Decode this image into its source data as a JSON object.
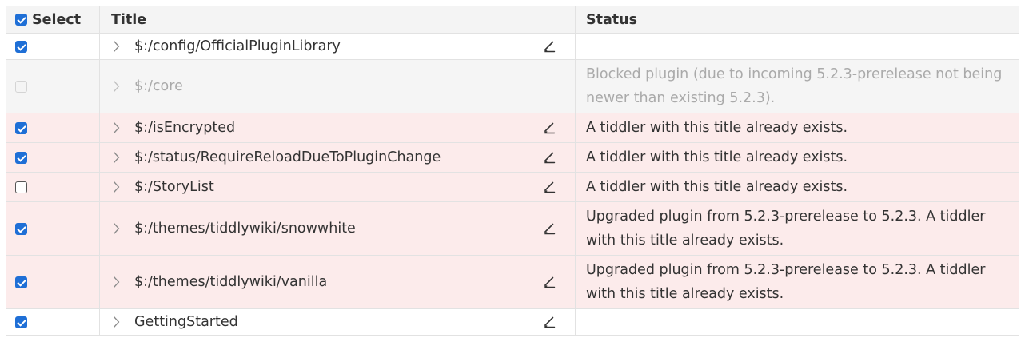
{
  "table": {
    "headers": {
      "select": "Select",
      "title": "Title",
      "status": "Status"
    },
    "select_all_checked": true,
    "rows": [
      {
        "checked": "checked",
        "title": "$:/config/OfficialPluginLibrary",
        "status": "",
        "editable": true,
        "variant": "normal",
        "chevron_icon": "chevron-right-icon",
        "edit_icon": "pencil-icon"
      },
      {
        "checked": "disabled",
        "title": "$:/core",
        "status": "Blocked plugin (due to incoming 5.2.3-prerelease not being newer than existing 5.2.3).",
        "editable": false,
        "variant": "blocked",
        "chevron_icon": "chevron-right-icon"
      },
      {
        "checked": "checked",
        "title": "$:/isEncrypted",
        "status": "A tiddler with this title already exists.",
        "editable": true,
        "variant": "warn",
        "chevron_icon": "chevron-right-icon",
        "edit_icon": "pencil-icon"
      },
      {
        "checked": "checked",
        "title": "$:/status/RequireReloadDueToPluginChange",
        "status": "A tiddler with this title already exists.",
        "editable": true,
        "variant": "warn",
        "chevron_icon": "chevron-right-icon",
        "edit_icon": "pencil-icon"
      },
      {
        "checked": "unchecked",
        "title": "$:/StoryList",
        "status": "A tiddler with this title already exists.",
        "editable": true,
        "variant": "warn",
        "chevron_icon": "chevron-right-icon",
        "edit_icon": "pencil-icon"
      },
      {
        "checked": "checked",
        "title": "$:/themes/tiddlywiki/snowwhite",
        "status": "Upgraded plugin from 5.2.3-prerelease to 5.2.3. A tiddler with this title already exists.",
        "editable": true,
        "variant": "warn",
        "chevron_icon": "chevron-right-icon",
        "edit_icon": "pencil-icon"
      },
      {
        "checked": "checked",
        "title": "$:/themes/tiddlywiki/vanilla",
        "status": "Upgraded plugin from 5.2.3-prerelease to 5.2.3. A tiddler with this title already exists.",
        "editable": true,
        "variant": "warn",
        "chevron_icon": "chevron-right-icon",
        "edit_icon": "pencil-icon"
      },
      {
        "checked": "checked",
        "title": "GettingStarted",
        "status": "",
        "editable": true,
        "variant": "normal",
        "chevron_icon": "chevron-right-icon",
        "edit_icon": "pencil-icon"
      }
    ]
  },
  "colors": {
    "checkbox_accent": "#1f6fd6",
    "warn_row_background": "#fcebeb",
    "blocked_row_background": "#f5f5f5",
    "header_background": "#f4f4f4"
  }
}
